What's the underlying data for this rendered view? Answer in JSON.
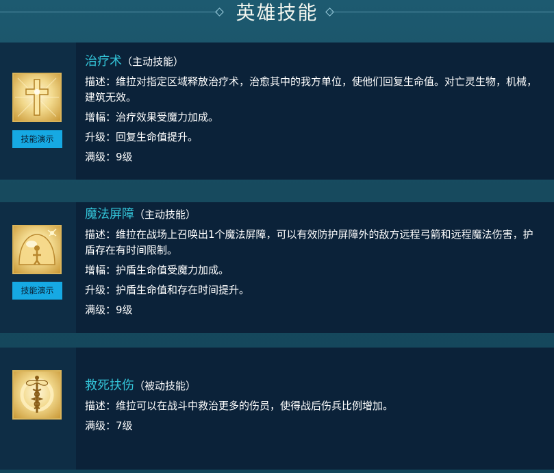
{
  "header": {
    "title": "英雄技能"
  },
  "skills": [
    {
      "name": "治疗术",
      "type": "（主动技能）",
      "icon": "cross-icon",
      "demo_label": "技能演示",
      "lines": [
        {
          "label": "描述：",
          "text": "维拉对指定区域释放治疗术，治愈其中的我方单位，使他们回复生命值。对亡灵生物，机械，建筑无效。"
        },
        {
          "label": "增幅：",
          "text": "治疗效果受魔力加成。"
        },
        {
          "label": "升级：",
          "text": "回复生命值提升。"
        },
        {
          "label": "满级：",
          "text": "9级"
        }
      ]
    },
    {
      "name": "魔法屏障",
      "type": "（主动技能）",
      "icon": "shield-bubble-icon",
      "demo_label": "技能演示",
      "lines": [
        {
          "label": "描述：",
          "text": "维拉在战场上召唤出1个魔法屏障，可以有效防护屏障外的敌方远程弓箭和远程魔法伤害，护盾存在有时间限制。"
        },
        {
          "label": "增幅：",
          "text": "护盾生命值受魔力加成。"
        },
        {
          "label": "升级：",
          "text": "护盾生命值和存在时间提升。"
        },
        {
          "label": "满级：",
          "text": "9级"
        }
      ]
    },
    {
      "name": "救死扶伤",
      "type": "（被动技能）",
      "icon": "caduceus-icon",
      "lines": [
        {
          "label": "描述：",
          "text": "维拉可以在战斗中救治更多的伤员，使得战后伤兵比例增加。"
        },
        {
          "label": "满级：",
          "text": "7级"
        }
      ]
    }
  ]
}
